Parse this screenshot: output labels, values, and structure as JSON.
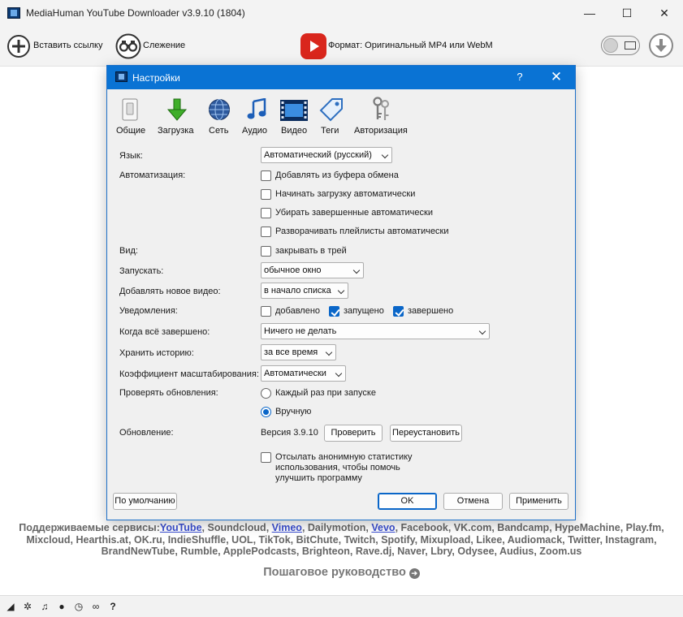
{
  "window": {
    "title": "MediaHuman YouTube Downloader v3.9.10 (1804)",
    "minimize": "—",
    "maximize": "☐",
    "close": "✕"
  },
  "toolbar": {
    "add_link": "Вставить ссылку",
    "tracking": "Слежение",
    "format": "Формат: Оригинальный MP4 или WebM"
  },
  "dialog": {
    "title": "Настройки",
    "help": "?",
    "close": "✕",
    "tabs": {
      "general": "Общие",
      "download": "Загрузка",
      "network": "Сеть",
      "audio": "Аудио",
      "video": "Видео",
      "tags": "Теги",
      "auth": "Авторизация"
    },
    "language_label": "Язык:",
    "language_value": "Автоматический (русский)",
    "automation_label": "Автоматизация:",
    "auto_clipboard": "Добавлять из буфера обмена",
    "auto_start": "Начинать загрузку автоматически",
    "auto_remove": "Убирать завершенные автоматически",
    "auto_expand": "Разворачивать плейлисты автоматически",
    "view_label": "Вид:",
    "close_to_tray": "закрывать в трей",
    "launch_label": "Запускать:",
    "launch_value": "обычное окно",
    "add_new_label": "Добавлять новое видео:",
    "add_new_value": "в начало списка",
    "notify_label": "Уведомления:",
    "notify_added": "добавлено",
    "notify_started": "запущено",
    "notify_finished": "завершено",
    "when_done_label": "Когда всё завершено:",
    "when_done_value": "Ничего не делать",
    "history_label": "Хранить историю:",
    "history_value": "за все время",
    "scale_label": "Коэффициент масштабирования:",
    "scale_value": "Автоматически",
    "updates_label": "Проверять обновления:",
    "update_each_start": "Каждый раз при запуске",
    "update_manual": "Вручную",
    "update_label": "Обновление:",
    "version_text": "Версия 3.9.10",
    "check_button": "Проверить",
    "reinstall_button": "Переустановить",
    "stats_line1": "Отсылать анонимную статистику",
    "stats_line2": "использования, чтобы помочь",
    "stats_line3": "улучшить программу",
    "defaults_button": "По умолчанию",
    "ok_button": "OK",
    "cancel_button": "Отмена",
    "apply_button": "Применить",
    "state": {
      "auto_clipboard": false,
      "auto_start": false,
      "auto_remove": false,
      "auto_expand": false,
      "close_to_tray": false,
      "notify_added": false,
      "notify_started": true,
      "notify_finished": true,
      "update_mode": "manual",
      "send_stats": false
    }
  },
  "services": {
    "prefix": "Поддерживаемые сервисы:",
    "youtube": "YouTube",
    "sep1": ", Soundcloud, ",
    "vimeo": "Vimeo",
    "sep2": ", Dailymotion, ",
    "vevo": "Vevo",
    "rest": ", Facebook, VK.com, Bandcamp, HypeMachine, Play.fm, Mixcloud, Hearthis.at, OK.ru, IndieShuffle, UOL, TikTok, BitChute, Twitch, Spotify, Mixupload, Likee, Audiomack, Twitter, Instagram, BrandNewTube, Rumble, ApplePodcasts, Brighteon, Rave.dj, Naver, Lbry, Odysee, Audius, Zoom.us"
  },
  "guide": "Пошаговое руководство",
  "colors": {
    "accent": "#0a73d4",
    "youtube_red": "#d9261c",
    "link": "#3b4fd1"
  }
}
